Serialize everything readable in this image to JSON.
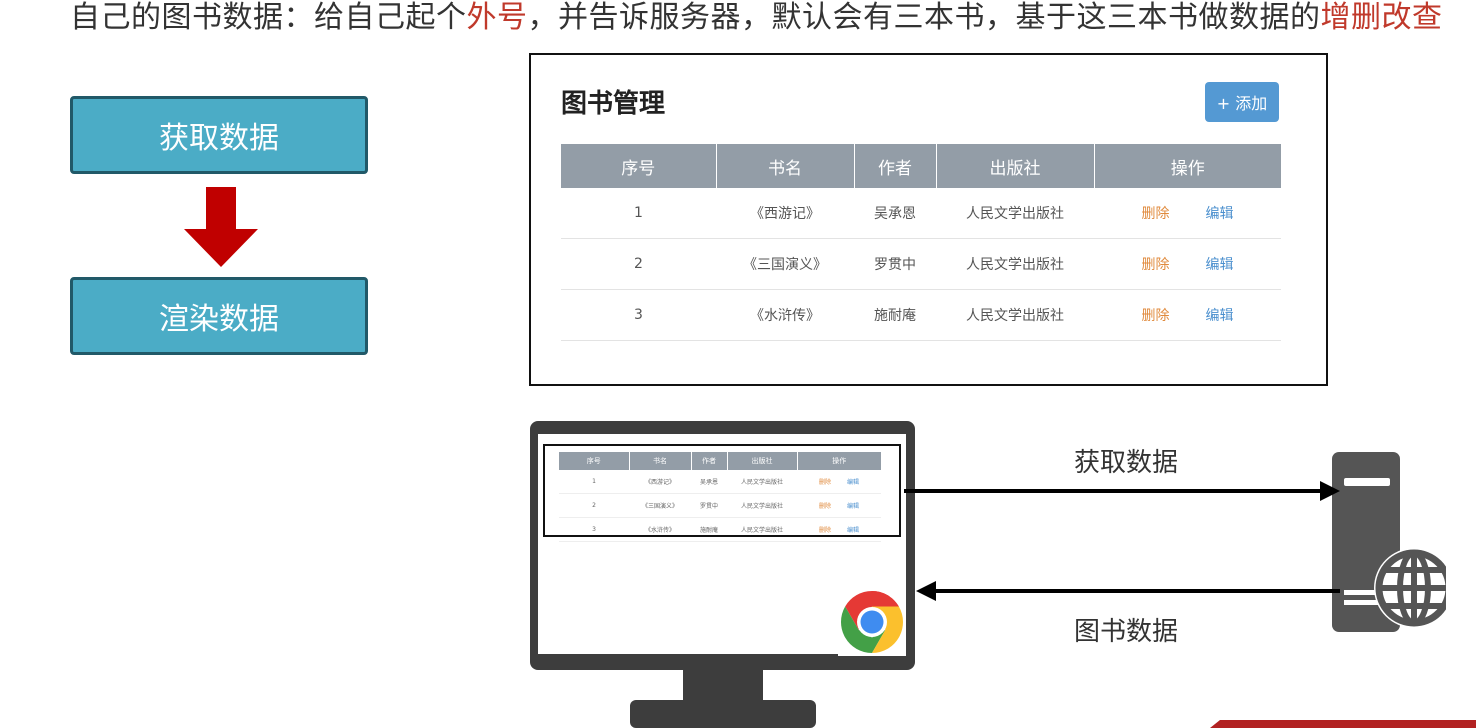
{
  "headline": {
    "part1": "自己的图书数据：给自己起个",
    "highlight1": "外号",
    "part2": "，并告诉服务器，默认会有三本书，基于这三本书做数据的",
    "highlight2": "增删改查"
  },
  "flow": {
    "step1": "获取数据",
    "step2": "渲染数据"
  },
  "panel": {
    "title": "图书管理",
    "add_button": "+ 添加",
    "columns": [
      "序号",
      "书名",
      "作者",
      "出版社",
      "操作"
    ],
    "rows": [
      {
        "id": "1",
        "name": "《西游记》",
        "author": "吴承恩",
        "publisher": "人民文学出版社",
        "delete": "删除",
        "edit": "编辑"
      },
      {
        "id": "2",
        "name": "《三国演义》",
        "author": "罗贯中",
        "publisher": "人民文学出版社",
        "delete": "删除",
        "edit": "编辑"
      },
      {
        "id": "3",
        "name": "《水浒传》",
        "author": "施耐庵",
        "publisher": "人民文学出版社",
        "delete": "删除",
        "edit": "编辑"
      }
    ]
  },
  "network": {
    "request_label": "获取数据",
    "response_label": "图书数据"
  },
  "colors": {
    "flow_box": "#4bacc6",
    "flow_border": "#215968",
    "arrow_red": "#c00000",
    "table_header": "#939da7",
    "add_button": "#5499d3",
    "highlight": "#c0392b"
  }
}
